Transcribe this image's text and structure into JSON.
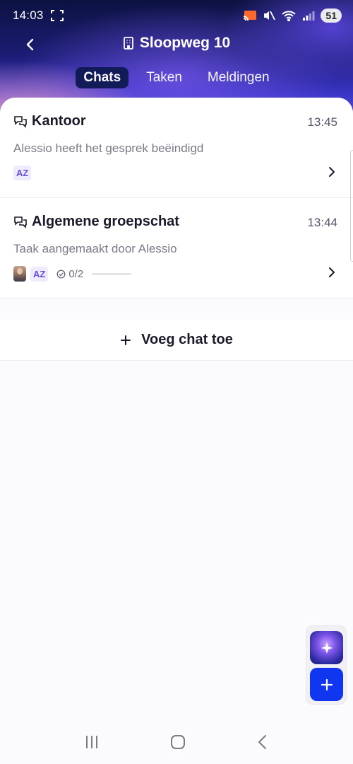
{
  "status_bar": {
    "time": "14:03",
    "battery": "51"
  },
  "header": {
    "title": "Sloopweg 10",
    "back_icon": "chevron-left-icon",
    "building_icon": "building-icon"
  },
  "tabs": [
    {
      "label": "Chats",
      "active": true
    },
    {
      "label": "Taken",
      "active": false
    },
    {
      "label": "Meldingen",
      "active": false
    }
  ],
  "chats": [
    {
      "title": "Kantoor",
      "time": "13:45",
      "subtitle": "Alessio heeft het gesprek beëindigd",
      "participants": [
        "AZ"
      ]
    },
    {
      "title": "Algemene groepschat",
      "time": "13:44",
      "subtitle": "Taak aangemaakt door Alessio",
      "participants": [
        "AZ"
      ],
      "tasks": "0/2",
      "task_progress": 0
    }
  ],
  "add_chat": {
    "label": "Voeg chat toe"
  },
  "fabs": {
    "ai_icon": "sparkle-icon",
    "add_icon": "plus-icon"
  },
  "colors": {
    "accent": "#1036f0",
    "active_tab": "#0e1a52",
    "initials": "#6a4fd8"
  }
}
